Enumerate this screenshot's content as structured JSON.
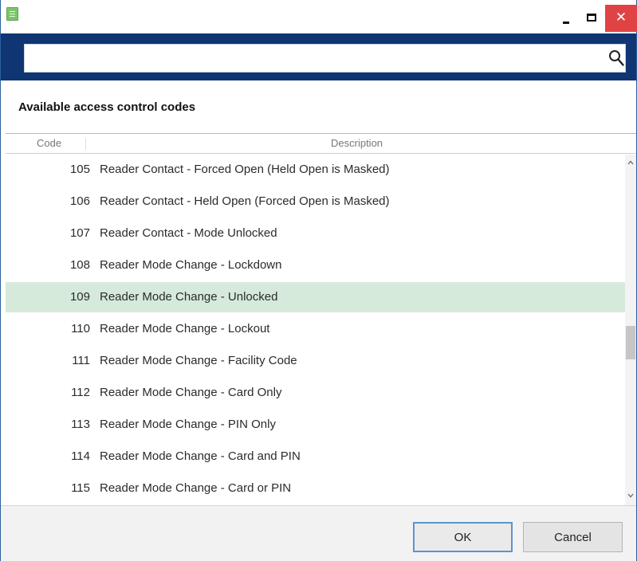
{
  "window": {
    "minimize_icon": "minimize-icon",
    "maximize_icon": "maximize-icon",
    "close_glyph": "✕"
  },
  "search": {
    "value": "",
    "placeholder": "",
    "icon": "search-icon"
  },
  "section": {
    "title": "Available access control codes"
  },
  "columns": {
    "code": "Code",
    "description": "Description"
  },
  "rows": [
    {
      "code": "105",
      "description": "Reader Contact - Forced Open (Held Open is Masked)"
    },
    {
      "code": "106",
      "description": "Reader Contact - Held Open (Forced Open is Masked)"
    },
    {
      "code": "107",
      "description": "Reader Contact - Mode Unlocked"
    },
    {
      "code": "108",
      "description": "Reader Mode Change - Lockdown"
    },
    {
      "code": "109",
      "description": "Reader Mode Change - Unlocked",
      "selected": true
    },
    {
      "code": "110",
      "description": "Reader Mode Change - Lockout"
    },
    {
      "code": "111",
      "description": "Reader Mode Change - Facility Code"
    },
    {
      "code": "112",
      "description": "Reader Mode Change - Card Only"
    },
    {
      "code": "113",
      "description": "Reader Mode Change - PIN Only"
    },
    {
      "code": "114",
      "description": "Reader Mode Change - Card and PIN"
    },
    {
      "code": "115",
      "description": "Reader Mode Change - Card or PIN"
    }
  ],
  "colors": {
    "accent": "#0f3572",
    "selected_row": "#d5eada",
    "close_button": "#e04343"
  },
  "footer": {
    "ok_label": "OK",
    "cancel_label": "Cancel"
  }
}
